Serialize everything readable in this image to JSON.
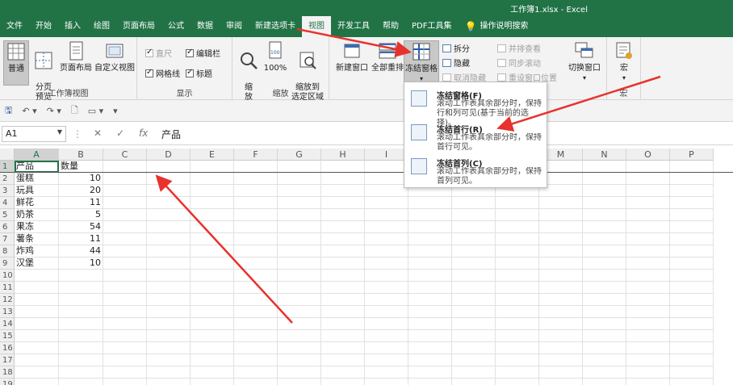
{
  "window": {
    "title": "工作簿1.xlsx  -  Excel"
  },
  "tabs": [
    "文件",
    "开始",
    "插入",
    "绘图",
    "页面布局",
    "公式",
    "数据",
    "审阅",
    "新建选项卡",
    "视图",
    "开发工具",
    "帮助",
    "PDF工具集"
  ],
  "active_tab": "视图",
  "tell_me": "操作说明搜索",
  "ribbon": {
    "views": {
      "normal": "普通",
      "page_break": "分页\n预览",
      "page_layout": "页面布局",
      "custom": "自定义视图",
      "label": "工作簿视图"
    },
    "show": {
      "ruler": "直尺",
      "formula_bar": "编辑栏",
      "gridlines": "网格线",
      "headings": "标题",
      "label": "显示"
    },
    "zoom": {
      "zoom": "缩\n放",
      "hundred": "100%",
      "selection": "缩放到\n选定区域",
      "label": "缩放"
    },
    "window": {
      "new_window": "新建窗口",
      "arrange_all": "全部重排",
      "freeze_panes": "冻结窗格",
      "split": "拆分",
      "hide": "隐藏",
      "unhide": "取消隐藏",
      "side_by_side": "并排查看",
      "sync_scroll": "同步滚动",
      "reset_position": "重设窗口位置",
      "switch": "切换窗口"
    },
    "macros": {
      "macros": "宏",
      "label": "宏"
    }
  },
  "formula_bar": {
    "name_box": "A1",
    "value": "产品",
    "fx": "fx"
  },
  "columns": [
    "A",
    "B",
    "C",
    "D",
    "E",
    "F",
    "G",
    "H",
    "I",
    "J",
    "K",
    "L",
    "M",
    "N",
    "O",
    "P"
  ],
  "rows": [
    [
      "产品",
      "数量"
    ],
    [
      "蛋糕",
      "10"
    ],
    [
      "玩具",
      "20"
    ],
    [
      "鲜花",
      "11"
    ],
    [
      "奶茶",
      "5"
    ],
    [
      "果冻",
      "54"
    ],
    [
      "薯条",
      "11"
    ],
    [
      "炸鸡",
      "44"
    ],
    [
      "汉堡",
      "10"
    ]
  ],
  "row_numbers": [
    "1",
    "2",
    "3",
    "4",
    "5",
    "6",
    "7",
    "8",
    "9",
    "10",
    "11",
    "12",
    "13",
    "14",
    "15",
    "16",
    "17",
    "18",
    "19"
  ],
  "freeze_menu": [
    {
      "title": "冻结窗格(F)",
      "desc": "滚动工作表其余部分时，保持行和列可见(基于当前的选择)。"
    },
    {
      "title": "冻结首行(R)",
      "desc": "滚动工作表其余部分时，保持首行可见。"
    },
    {
      "title": "冻结首列(C)",
      "desc": "滚动工作表其余部分时，保持首列可见。"
    }
  ],
  "colors": {
    "brand": "#217346",
    "arrow": "#e8322e"
  }
}
